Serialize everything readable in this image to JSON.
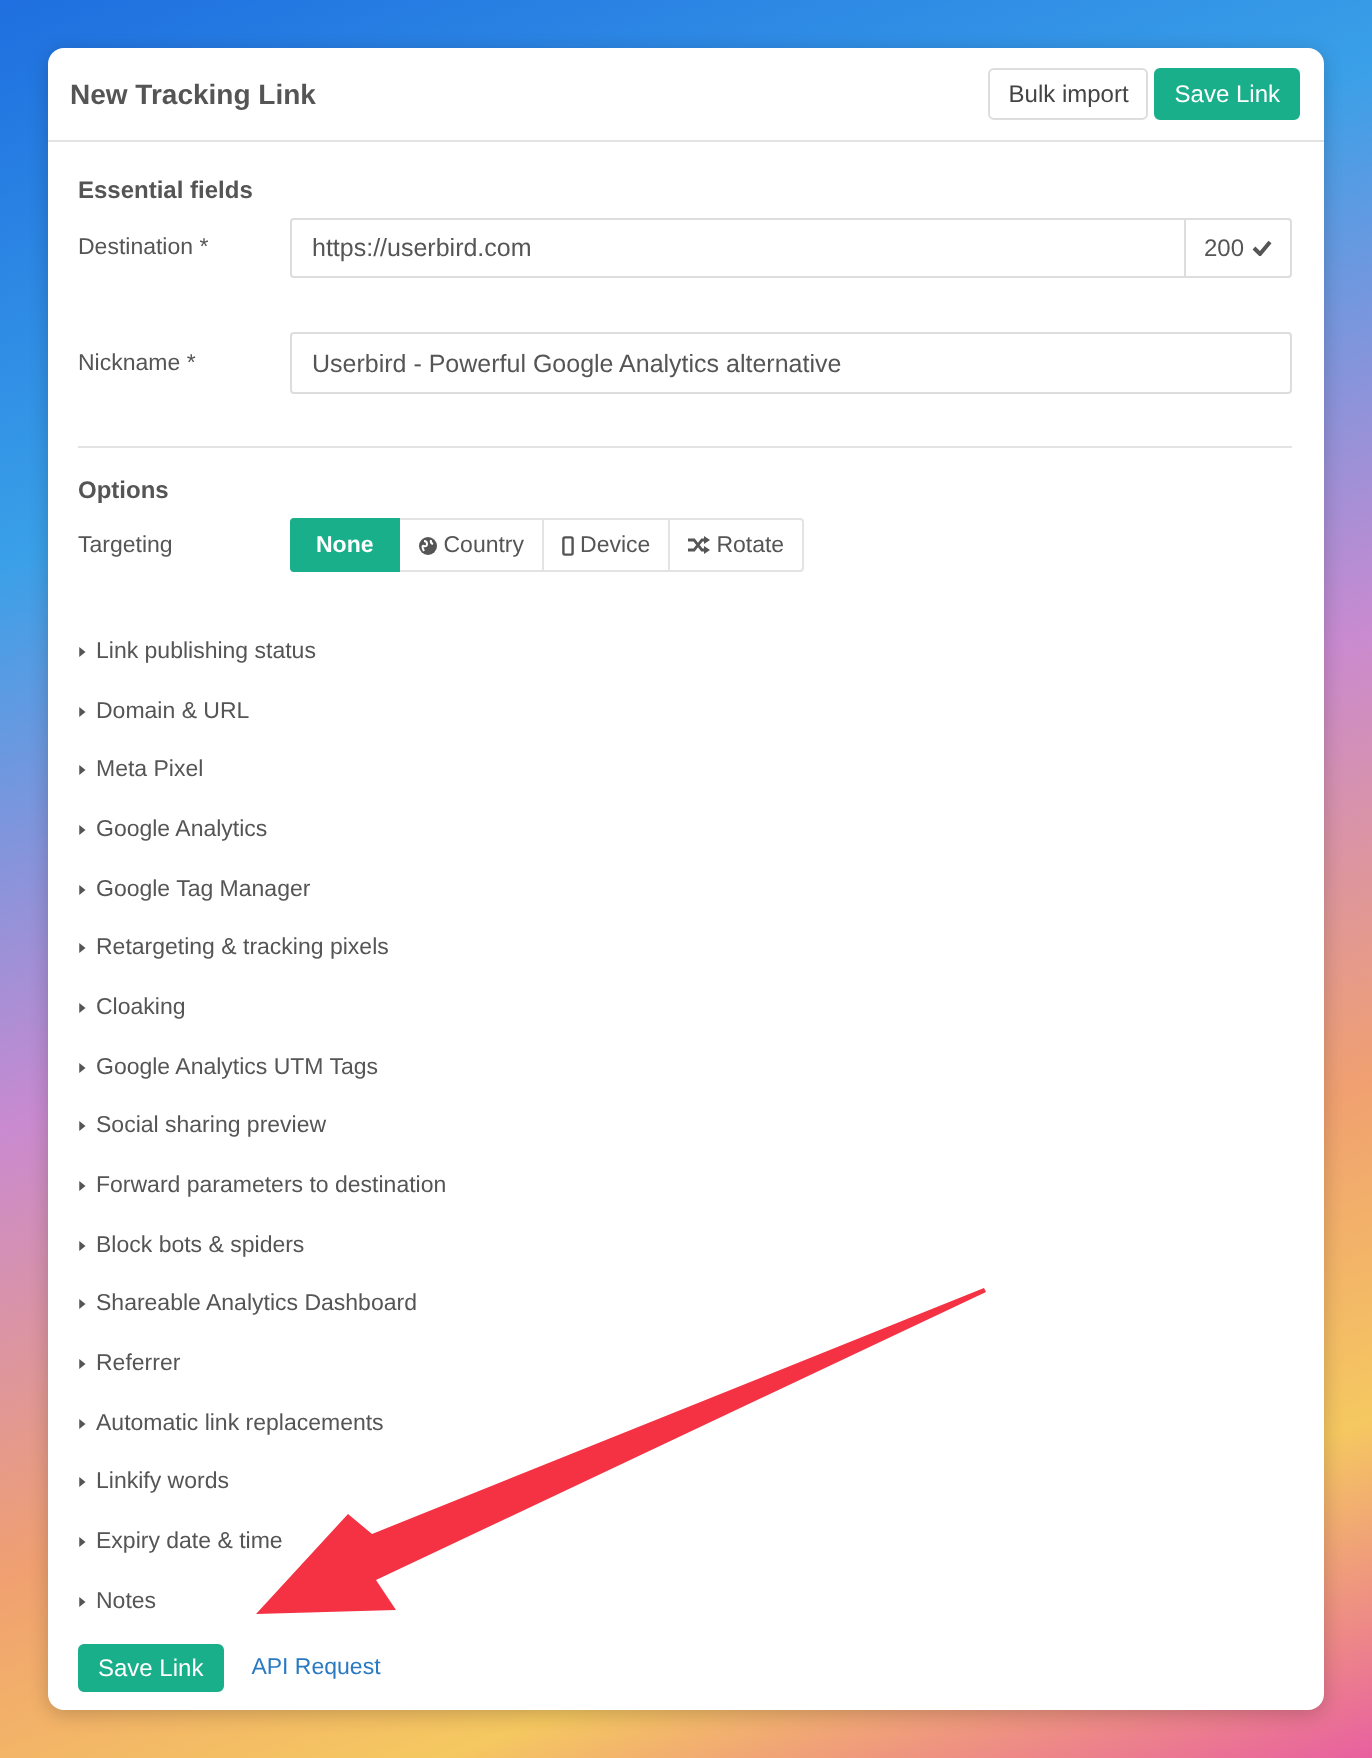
{
  "dialog": {
    "title": "New Tracking Link",
    "header_buttons": [
      {
        "label": "Bulk import",
        "kind": "secondary"
      },
      {
        "label": "Save Link",
        "kind": "primary"
      }
    ]
  },
  "essential": {
    "heading": "Essential fields",
    "destination": {
      "label": "Destination *",
      "value": "https://userbird.com",
      "status": "200"
    },
    "nickname": {
      "label": "Nickname *",
      "value": "Userbird - Powerful Google Analytics alternative"
    }
  },
  "options": {
    "heading": "Options",
    "targeting": {
      "label": "Targeting",
      "choices": [
        {
          "label": "None",
          "selected": true
        },
        {
          "label": "Country",
          "selected": false
        },
        {
          "label": "Device",
          "selected": false
        },
        {
          "label": "Rotate",
          "selected": false
        }
      ]
    },
    "sections": [
      {
        "label": "Link publishing status",
        "expanded": false
      },
      {
        "label": "Domain & URL",
        "expanded": false
      },
      {
        "label": "Meta Pixel",
        "expanded": false
      },
      {
        "label": "Google Analytics",
        "expanded": false
      },
      {
        "label": "Google Tag Manager",
        "expanded": false
      },
      {
        "label": "Retargeting & tracking pixels",
        "expanded": false
      },
      {
        "label": "Cloaking",
        "expanded": false
      },
      {
        "label": "Google Analytics UTM Tags",
        "expanded": false
      },
      {
        "label": "Social sharing preview",
        "expanded": false
      },
      {
        "label": "Forward parameters to destination",
        "expanded": false
      },
      {
        "label": "Block bots & spiders",
        "expanded": false
      },
      {
        "label": "Shareable Analytics Dashboard",
        "expanded": false
      },
      {
        "label": "Referrer",
        "expanded": false
      },
      {
        "label": "Automatic link replacements",
        "expanded": false
      },
      {
        "label": "Linkify words",
        "expanded": false
      },
      {
        "label": "Expiry date & time",
        "expanded": false
      },
      {
        "label": "Notes",
        "expanded": false
      }
    ]
  },
  "footer": {
    "save_button": "Save Link",
    "api_link": "API Request"
  }
}
